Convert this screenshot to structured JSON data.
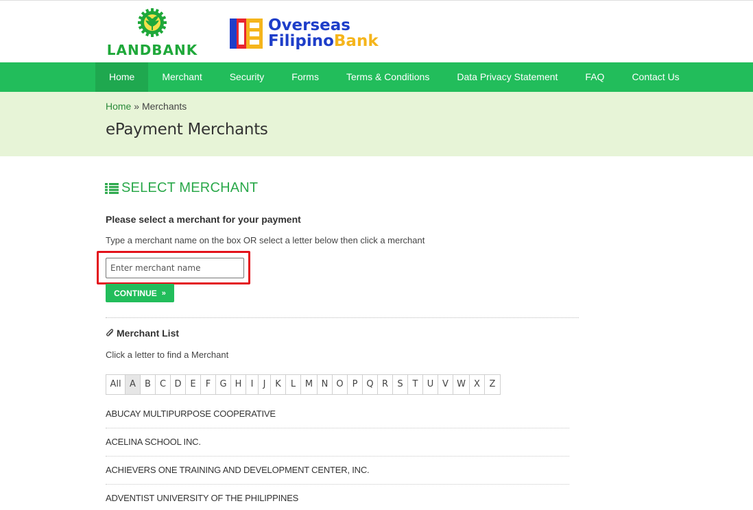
{
  "header": {
    "landbank_logo_text": "LANDBANK",
    "ofb_logo_line1": "Overseas",
    "ofb_logo_line2a": "Filipino",
    "ofb_logo_line2b": "Bank"
  },
  "nav": {
    "items": [
      {
        "label": "Home",
        "active": true
      },
      {
        "label": "Merchant"
      },
      {
        "label": "Security"
      },
      {
        "label": "Forms"
      },
      {
        "label": "Terms & Conditions"
      },
      {
        "label": "Data Privacy Statement"
      },
      {
        "label": "FAQ"
      },
      {
        "label": "Contact Us"
      }
    ]
  },
  "breadcrumb": {
    "home": "Home",
    "separator": " » ",
    "current": "Merchants"
  },
  "page_title": "ePayment Merchants",
  "main": {
    "section_title": "SELECT MERCHANT",
    "subtitle": "Please select a merchant for your payment",
    "instruction": "Type a merchant name on the box OR select a letter below then click a merchant",
    "search_placeholder": "Enter merchant name",
    "search_value": "",
    "continue_label": "CONTINUE",
    "list_title": "Merchant List",
    "list_hint": "Click a letter to find a Merchant"
  },
  "letters": [
    "All",
    "A",
    "B",
    "C",
    "D",
    "E",
    "F",
    "G",
    "H",
    "I",
    "J",
    "K",
    "L",
    "M",
    "N",
    "O",
    "P",
    "Q",
    "R",
    "S",
    "T",
    "U",
    "V",
    "W",
    "X",
    "Z"
  ],
  "active_letter": "A",
  "merchants": [
    "ABUCAY MULTIPURPOSE COOPERATIVE",
    "ACELINA SCHOOL INC.",
    "ACHIEVERS ONE TRAINING AND DEVELOPMENT CENTER, INC.",
    "ADVENTIST UNIVERSITY OF THE PHILIPPINES"
  ],
  "colors": {
    "brand_green": "#22bd5b",
    "band_bg": "#e7f4d7",
    "highlight_red": "#e3121b",
    "ofb_blue": "#1e3ec9",
    "ofb_yellow": "#f5b51c"
  }
}
